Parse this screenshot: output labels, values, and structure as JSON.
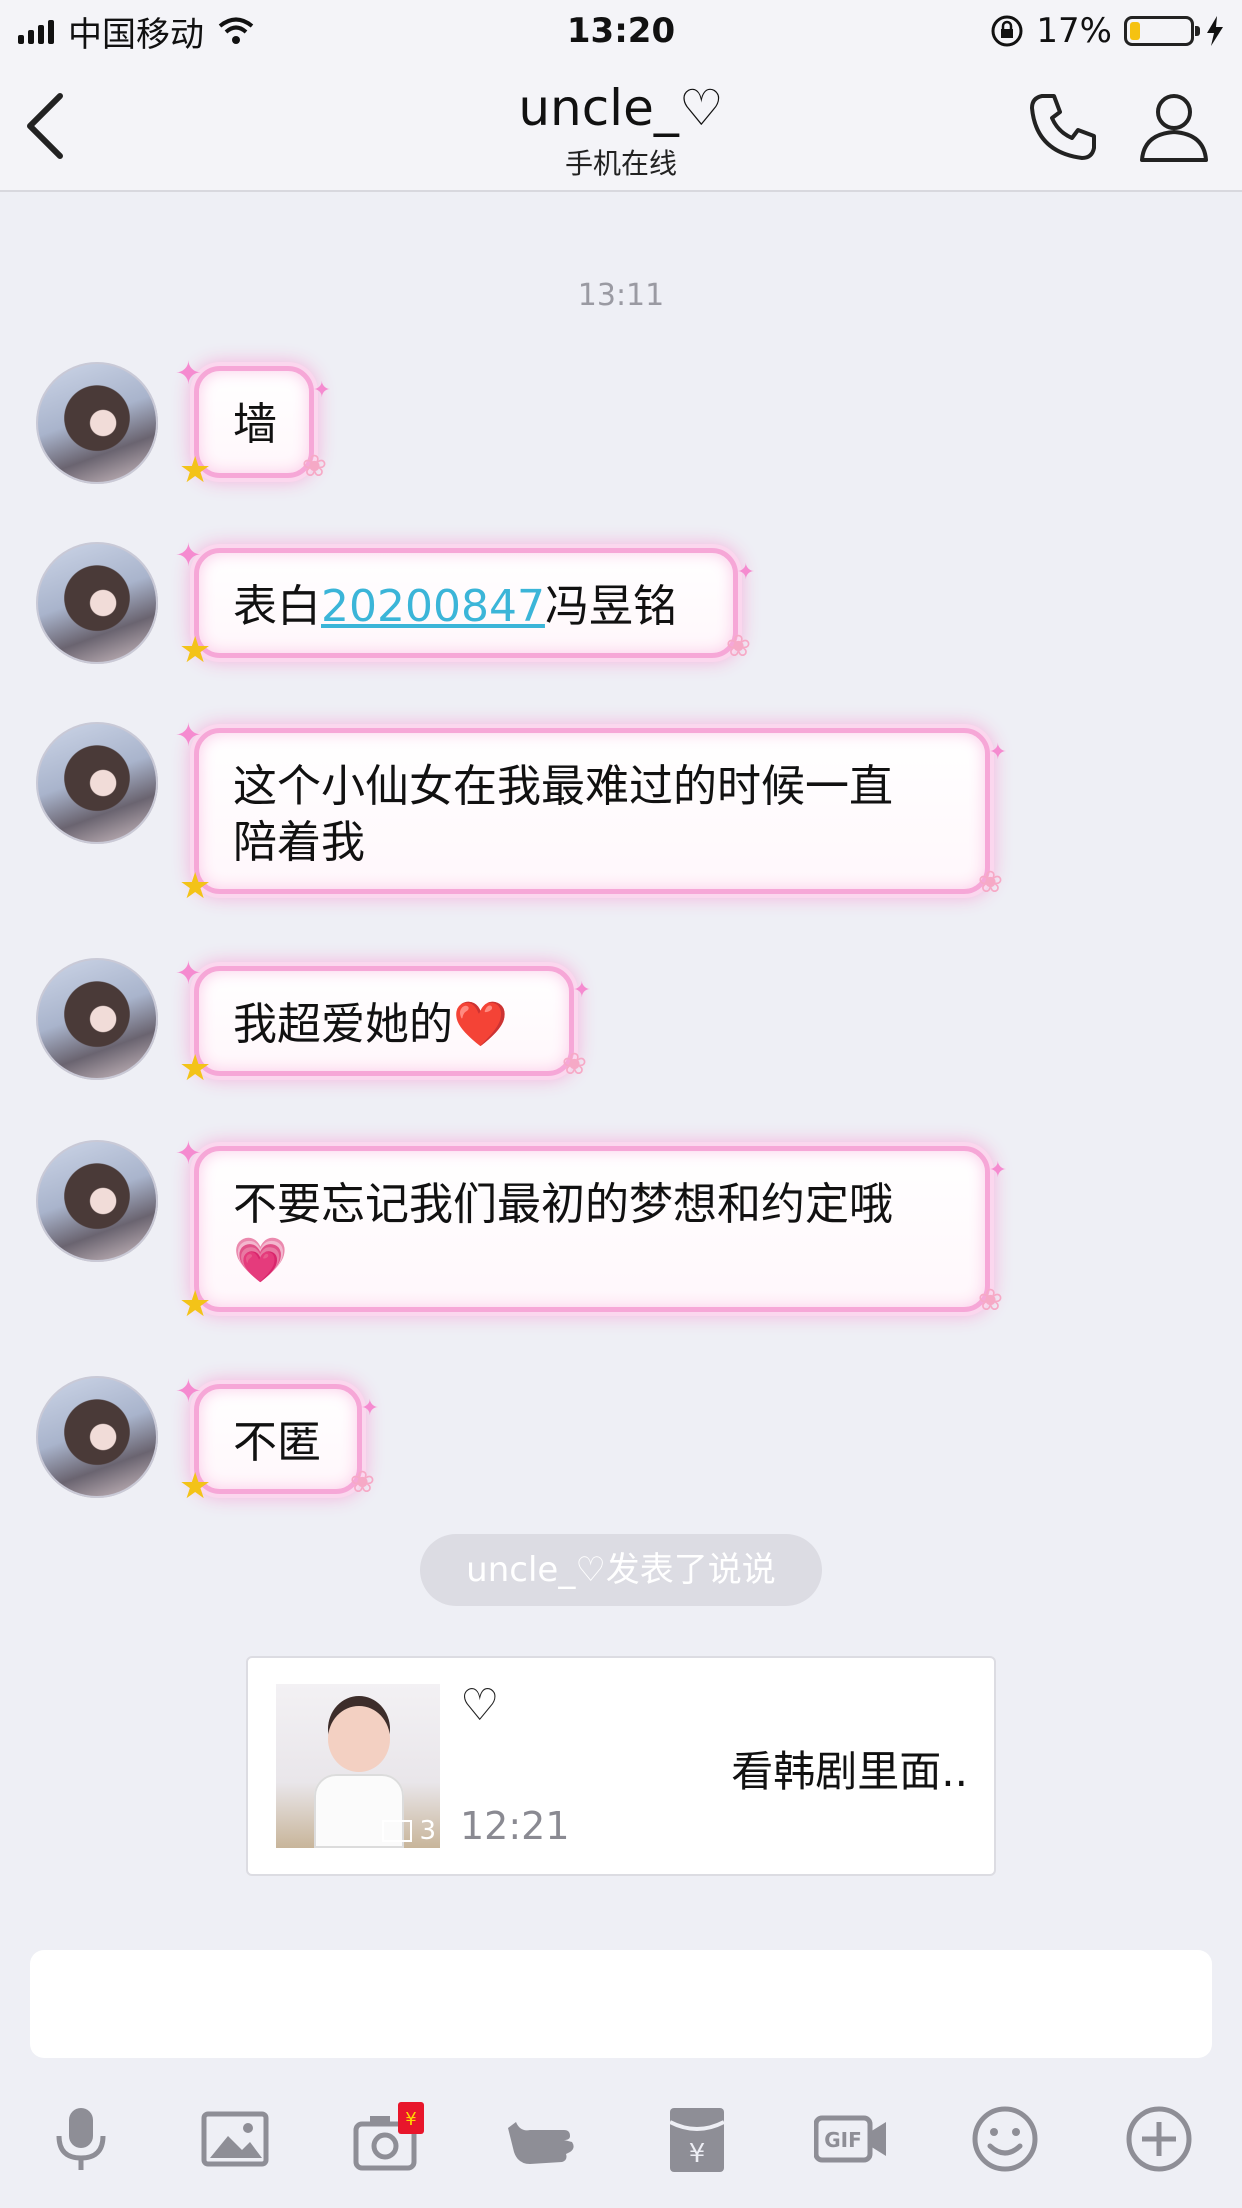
{
  "status_bar": {
    "carrier": "中国移动",
    "time": "13:20",
    "battery_percent": "17%",
    "battery_level": 0.17
  },
  "nav": {
    "title": "uncle_♡",
    "subtitle": "手机在线",
    "icons": [
      "back-chevron-icon",
      "phone-call-icon",
      "profile-icon"
    ]
  },
  "chat": {
    "timestamp": "13:11",
    "messages": [
      {
        "text": "墙"
      },
      {
        "prefix": "表白",
        "link": "20200847",
        "suffix": "冯昱铭"
      },
      {
        "line1": "这个小仙女在我最难过的时候一直",
        "line2": "陪着我"
      },
      {
        "text": "我超爱她的",
        "emoji": "❤️"
      },
      {
        "line1": "不要忘记我们最初的梦想和约定哦",
        "emoji": "💗"
      },
      {
        "text": "不匿"
      }
    ],
    "system_notice": "uncle_♡发表了说说",
    "post_card": {
      "heart": "♡",
      "text": "看韩剧里面..",
      "time": "12:21",
      "photo_count": "3"
    }
  },
  "toolbar": {
    "icons": [
      "microphone-icon",
      "image-icon",
      "camera-redpacket-icon",
      "poke-hand-icon",
      "red-envelope-icon",
      "gif-icon",
      "emoji-icon",
      "plus-icon"
    ],
    "accent": "#8e8e96",
    "badge_color": "#e8162b"
  }
}
